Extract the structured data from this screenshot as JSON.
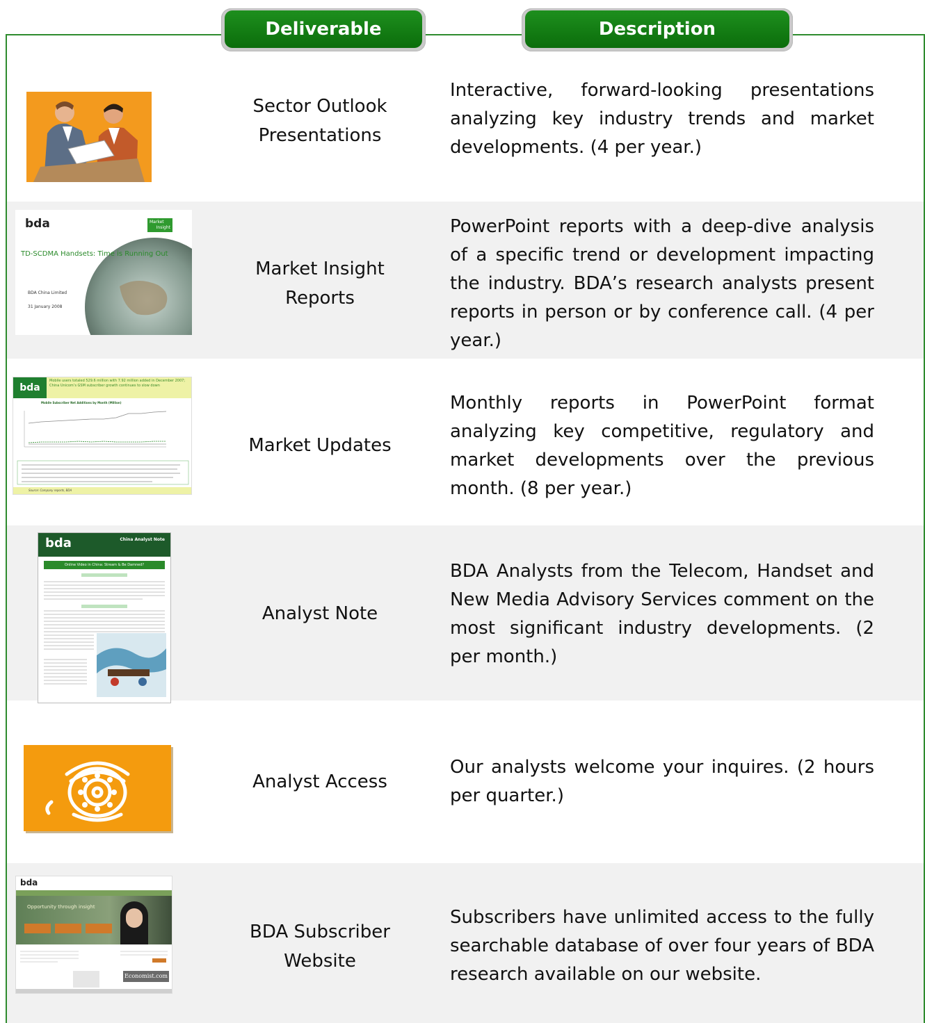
{
  "header": {
    "deliverable_label": "Deliverable",
    "description_label": "Description"
  },
  "rows": [
    {
      "deliverable": [
        "Sector Outlook",
        "Presentations"
      ],
      "description": "Interactive, forward-looking presentations analyzing key industry trends and market developments. (4 per year.)",
      "thumb_icon": "business-meeting-clipart-icon"
    },
    {
      "deliverable": [
        "Market Insight",
        "Reports"
      ],
      "description": "PowerPoint reports with a deep-dive analysis of a specific trend or development impacting the industry. BDA’s research analysts present reports in person or by conference call. (4 per year.)",
      "thumb": {
        "logo": "bda",
        "badge_line1": "Market",
        "badge_line2": "Insight",
        "title": "TD-SCDMA Handsets: Time is Running Out",
        "company": "BDA China Limited",
        "date": "31 January 2008"
      }
    },
    {
      "deliverable": [
        "Market Updates"
      ],
      "description": "Monthly reports in PowerPoint format analyzing key competitive, regulatory and market developments over the previous month. (8 per year.)",
      "thumb": {
        "logo": "bda",
        "headline": "Mobile users totaled 529.6 million with 7.92 million added in December 2007; China Unicom’s GSM subscriber growth continues to slow down",
        "chart_title": "Mobile Subscriber Net Additions by Month (Million)",
        "source": "Source: Company reports, BDA"
      }
    },
    {
      "deliverable": [
        "Analyst Note"
      ],
      "description": "BDA Analysts from the Telecom, Handset and New Media Advisory Services comment on the most significant industry developments. (2 per month.)",
      "thumb": {
        "logo": "bda",
        "note_title": "China Analyst Note",
        "headline": "Online Video in China: Stream & Be Damned?"
      }
    },
    {
      "deliverable": [
        "Analyst Access"
      ],
      "description": "Our analysts welcome your inquires. (2 hours per quarter.)",
      "thumb_icon": "telephone-icon"
    },
    {
      "deliverable": [
        "BDA Subscriber",
        "Website"
      ],
      "description": "Subscribers have unlimited access to the fully searchable database of over four years of BDA research available on our website.",
      "thumb": {
        "logo": "bda",
        "banner": "Opportunity through insight",
        "economist": "Economist.com"
      }
    }
  ]
}
